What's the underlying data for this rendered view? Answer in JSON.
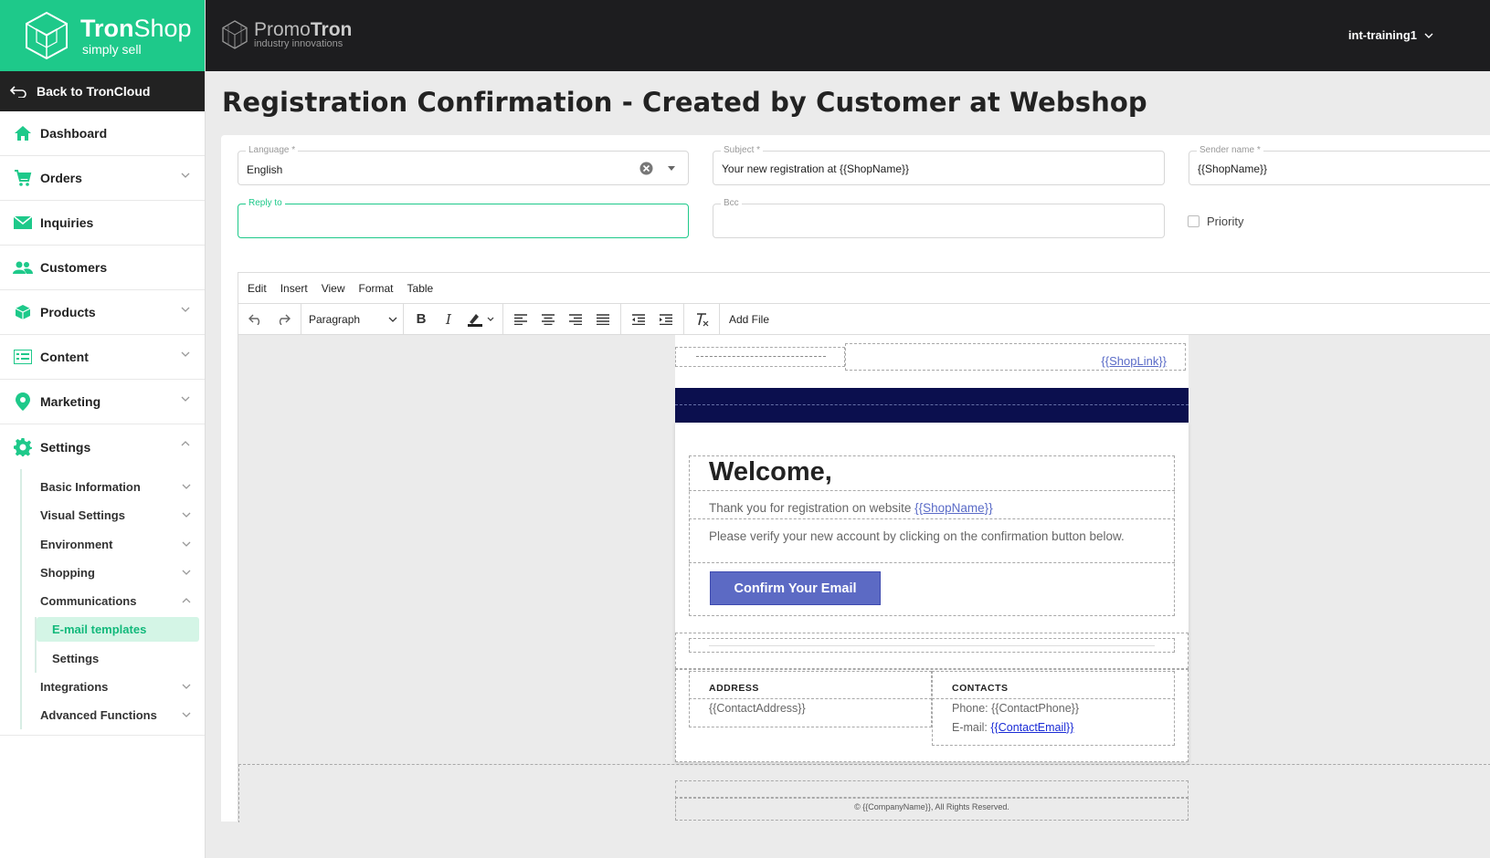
{
  "brand": {
    "name_bold": "Tron",
    "name_rest": "Shop",
    "tagline": "simply sell"
  },
  "promo": {
    "name_light": "Promo",
    "name_bold": "Tron",
    "tagline": "industry innovations"
  },
  "user": {
    "name": "int-training1"
  },
  "sidebar": {
    "back": "Back to TronCloud",
    "items": [
      {
        "label": "Dashboard",
        "icon": "home-icon"
      },
      {
        "label": "Orders",
        "icon": "cart-icon"
      },
      {
        "label": "Inquiries",
        "icon": "mail-icon"
      },
      {
        "label": "Customers",
        "icon": "people-icon"
      },
      {
        "label": "Products",
        "icon": "box-icon"
      },
      {
        "label": "Content",
        "icon": "list-icon"
      },
      {
        "label": "Marketing",
        "icon": "pin-icon"
      },
      {
        "label": "Settings",
        "icon": "gear-icon"
      }
    ],
    "settings_sub": [
      "Basic Information",
      "Visual Settings",
      "Environment",
      "Shopping",
      "Communications"
    ],
    "communications_sub": [
      "E-mail templates",
      "Settings"
    ],
    "settings_sub_after": [
      "Integrations",
      "Advanced Functions"
    ]
  },
  "page": {
    "title": "Registration Confirmation - Created by Customer at Webshop"
  },
  "form": {
    "language": {
      "label": "Language *",
      "value": "English"
    },
    "subject": {
      "label": "Subject *",
      "value": "Your new registration at {{ShopName}}"
    },
    "sender": {
      "label": "Sender name *",
      "value": "{{ShopName}}"
    },
    "reply_to": {
      "label": "Reply to",
      "value": ""
    },
    "bcc": {
      "label": "Bcc",
      "value": ""
    },
    "priority": {
      "label": "Priority",
      "checked": false
    }
  },
  "editor": {
    "menu": [
      "Edit",
      "Insert",
      "View",
      "Format",
      "Table"
    ],
    "block_format": "Paragraph",
    "add_file": "Add File"
  },
  "email": {
    "shop_link": "{{ShopLink}}",
    "welcome": "Welcome,",
    "thanks_text": "Thank you for registration on website ",
    "thanks_link": "{{ShopName}}",
    "verify": "Please verify your new account by clicking on the confirmation button below.",
    "confirm_button": "Confirm Your Email",
    "address_head": "ADDRESS",
    "address_value": "{{ContactAddress}}",
    "contacts_head": "CONTACTS",
    "phone": "Phone: {{ContactPhone}}",
    "email_prefix": "E-mail: ",
    "email_link": "{{ContactEmail}}",
    "copyright": "© {{CompanyName}}, All Rights Reserved."
  },
  "colors": {
    "brand_green": "#1ec98a",
    "topbar": "#1d1d1f",
    "navy_band": "#0b0f4e",
    "button": "#5c6ac4"
  }
}
